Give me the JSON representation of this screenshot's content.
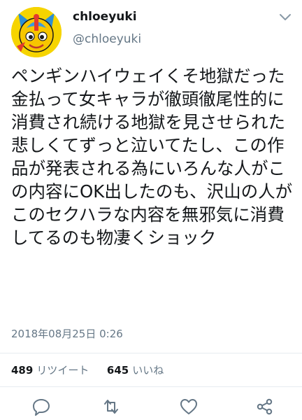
{
  "user": {
    "display_name": "chloeyuki",
    "handle": "@chloeyuki",
    "avatar_icon": "avatar-character-icon"
  },
  "tweet": {
    "text": "ペンギンハイウェイくそ地獄だった\n金払って女キャラが徹頭徹尾性的に消費され続ける地獄を見させられた\n悲しくてずっと泣いてたし、この作品が発表される為にいろんな人がこの内容にOK出したのも、沢山の人がこのセクハラな内容を無邪気に消費してるのも物凄くショック",
    "timestamp": "2018年08月25日 0:26"
  },
  "stats": {
    "retweets_count": "489",
    "retweets_label": "リツイート",
    "likes_count": "645",
    "likes_label": "いいね"
  },
  "actions": [
    "reply-icon",
    "retweet-icon",
    "like-icon",
    "share-icon"
  ],
  "colors": {
    "text": "#14171a",
    "secondary": "#657786",
    "divider": "#e6ecf0",
    "icon": "#657786"
  }
}
